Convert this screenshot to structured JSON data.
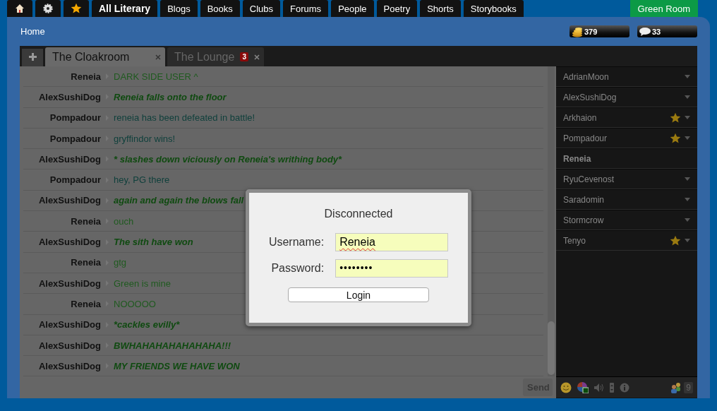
{
  "nav": {
    "tabs": [
      {
        "kind": "icon",
        "selected": false
      },
      {
        "kind": "icon",
        "selected": false
      },
      {
        "kind": "icon",
        "selected": false
      },
      {
        "kind": "text",
        "label": "All Literary",
        "selected": true
      },
      {
        "kind": "text",
        "label": "Blogs",
        "selected": false
      },
      {
        "kind": "text",
        "label": "Books",
        "selected": false
      },
      {
        "kind": "text",
        "label": "Clubs",
        "selected": false
      },
      {
        "kind": "text",
        "label": "Forums",
        "selected": false
      },
      {
        "kind": "text",
        "label": "People",
        "selected": false
      },
      {
        "kind": "text",
        "label": "Poetry",
        "selected": false
      },
      {
        "kind": "text",
        "label": "Shorts",
        "selected": false
      },
      {
        "kind": "text",
        "label": "Storybooks",
        "selected": false
      }
    ],
    "room_button": "Green Room"
  },
  "breadcrumb": "Home",
  "badges": [
    {
      "count": "379"
    },
    {
      "count": "33"
    }
  ],
  "chat_tabs": [
    {
      "label": "The Cloakroom",
      "selected": true
    },
    {
      "label": "The Lounge",
      "selected": false,
      "unread": "3"
    }
  ],
  "messages": [
    {
      "user": "Reneia",
      "text": "DARK SIDE USER ^",
      "kind": "say",
      "color": "#1f5a1f"
    },
    {
      "user": "AlexSushiDog",
      "text": "Reneia falls onto the floor",
      "kind": "action",
      "color": "#0f4a10"
    },
    {
      "user": "Pompadour",
      "text": "reneia has been defeated in battle!",
      "kind": "say",
      "color": "#10403c"
    },
    {
      "user": "Pompadour",
      "text": "gryffindor wins!",
      "kind": "say",
      "color": "#10403c"
    },
    {
      "user": "AlexSushiDog",
      "text": "* slashes down viciously on Reneia's writhing body*",
      "kind": "action",
      "color": "#0f4a10"
    },
    {
      "user": "Pompadour",
      "text": "hey, PG there",
      "kind": "say",
      "color": "#10403c"
    },
    {
      "user": "AlexSushiDog",
      "text": "again and again the blows fall",
      "kind": "action",
      "color": "#0f4a10"
    },
    {
      "user": "Reneia",
      "text": "ouch",
      "kind": "say",
      "color": "#1f5a1f"
    },
    {
      "user": "AlexSushiDog",
      "text": "The sith have won",
      "kind": "action",
      "color": "#0f4a10"
    },
    {
      "user": "Reneia",
      "text": "gtg",
      "kind": "say",
      "color": "#1f5a1f"
    },
    {
      "user": "AlexSushiDog",
      "text": "Green is mine",
      "kind": "say",
      "color": "#1f5a1f"
    },
    {
      "user": "Reneia",
      "text": "NOOOOO",
      "kind": "say",
      "color": "#1f5a1f"
    },
    {
      "user": "AlexSushiDog",
      "text": "*cackles evilly*",
      "kind": "action",
      "color": "#0f4a10"
    },
    {
      "user": "AlexSushiDog",
      "text": "BWHAHAHAHAHAHAHA!!!",
      "kind": "action",
      "color": "#0f4a10"
    },
    {
      "user": "AlexSushiDog",
      "text": "MY FRIENDS WE HAVE WON",
      "kind": "action",
      "color": "#0f4a10"
    }
  ],
  "send_button": "Send",
  "users": [
    {
      "name": "AdrianMoon",
      "starred": false,
      "current": false
    },
    {
      "name": "AlexSushiDog",
      "starred": false,
      "current": false
    },
    {
      "name": "Arkhaion",
      "starred": true,
      "current": false
    },
    {
      "name": "Pompadour",
      "starred": true,
      "current": false
    },
    {
      "name": "Reneia",
      "starred": false,
      "current": true
    },
    {
      "name": "RyuCevenost",
      "starred": false,
      "current": false
    },
    {
      "name": "Saradomin",
      "starred": false,
      "current": false
    },
    {
      "name": "Stormcrow",
      "starred": false,
      "current": false
    },
    {
      "name": "Tenyo",
      "starred": true,
      "current": false
    }
  ],
  "user_count": "9",
  "dialog": {
    "title": "Disconnected",
    "username_label": "Username:",
    "username": "Reneia",
    "password_label": "Password:",
    "password": "••••••••",
    "button": "Login"
  }
}
